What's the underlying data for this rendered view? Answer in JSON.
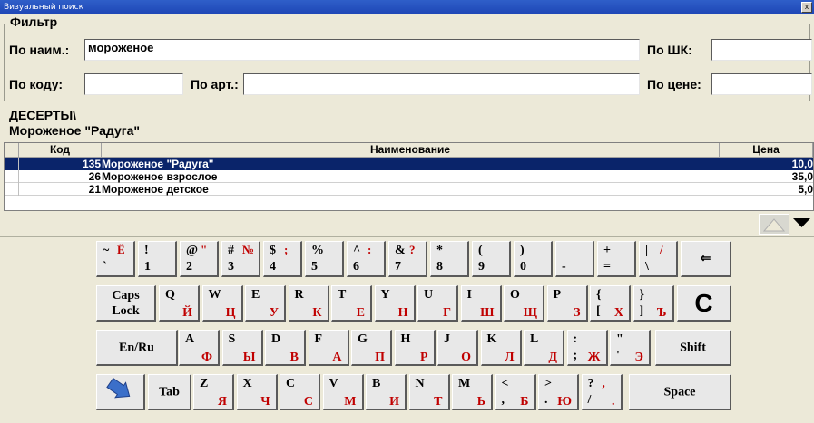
{
  "window": {
    "title": "Визуальный поиск",
    "close_glyph": "x"
  },
  "filter": {
    "legend": "Фильтр",
    "name_label": "По наим.:",
    "name_value": "мороженое",
    "barcode_label": "По ШК:",
    "barcode_value": "",
    "code_label": "По коду:",
    "code_value": "",
    "article_label": "По арт.:",
    "article_value": "",
    "price_label": "По цене:",
    "price_value": ""
  },
  "breadcrumb": {
    "folder": "ДЕСЕРТЫ\\",
    "item": "Мороженое \"Радуга\""
  },
  "table": {
    "headers": {
      "code": "Код",
      "name": "Наименование",
      "price": "Цена"
    },
    "rows": [
      {
        "code": "135",
        "name": "Мороженое \"Радуга\"",
        "price": "10,0",
        "selected": true
      },
      {
        "code": "26",
        "name": "Мороженое взрослое",
        "price": "35,0",
        "selected": false
      },
      {
        "code": "21",
        "name": "Мороженое детское",
        "price": "5,0",
        "selected": false
      }
    ]
  },
  "keyboard": {
    "row1": [
      {
        "t": "~",
        "r": "Ё",
        "b": "`",
        "rb": ""
      },
      {
        "t": "!",
        "r": "",
        "b": "1",
        "rb": ""
      },
      {
        "t": "@",
        "r": "\"",
        "b": "2",
        "rb": ""
      },
      {
        "t": "#",
        "r": "№",
        "b": "3",
        "rb": ""
      },
      {
        "t": "$",
        "r": ";",
        "b": "4",
        "rb": ""
      },
      {
        "t": "%",
        "r": "",
        "b": "5",
        "rb": ""
      },
      {
        "t": "^",
        "r": ":",
        "b": "6",
        "rb": ""
      },
      {
        "t": "&",
        "r": "?",
        "b": "7",
        "rb": ""
      },
      {
        "t": "*",
        "r": "",
        "b": "8",
        "rb": ""
      },
      {
        "t": "(",
        "r": "",
        "b": "9",
        "rb": ""
      },
      {
        "t": ")",
        "r": "",
        "b": "0",
        "rb": ""
      },
      {
        "t": "_",
        "r": "",
        "b": "-",
        "rb": ""
      },
      {
        "t": "+",
        "r": "",
        "b": "=",
        "rb": ""
      },
      {
        "t": "|",
        "r": "/",
        "b": "\\",
        "rb": ""
      }
    ],
    "backspace": "⇐",
    "caps": "Caps Lock",
    "row2": [
      {
        "t": "Q",
        "rb": "Й"
      },
      {
        "t": "W",
        "rb": "Ц"
      },
      {
        "t": "E",
        "rb": "У"
      },
      {
        "t": "R",
        "rb": "К"
      },
      {
        "t": "T",
        "rb": "Е"
      },
      {
        "t": "Y",
        "rb": "Н"
      },
      {
        "t": "U",
        "rb": "Г"
      },
      {
        "t": "I",
        "rb": "Ш"
      },
      {
        "t": "O",
        "rb": "Щ"
      },
      {
        "t": "P",
        "rb": "З"
      },
      {
        "t": "{",
        "b": "[",
        "rb": "Х"
      },
      {
        "t": "}",
        "b": "]",
        "rb": "Ъ"
      }
    ],
    "clear": "C",
    "lang": "En/Ru",
    "row3": [
      {
        "t": "A",
        "rb": "Ф"
      },
      {
        "t": "S",
        "rb": "Ы"
      },
      {
        "t": "D",
        "rb": "В"
      },
      {
        "t": "F",
        "rb": "А"
      },
      {
        "t": "G",
        "rb": "П"
      },
      {
        "t": "H",
        "rb": "Р"
      },
      {
        "t": "J",
        "rb": "О"
      },
      {
        "t": "K",
        "rb": "Л"
      },
      {
        "t": "L",
        "rb": "Д"
      },
      {
        "t": ":",
        "b": ";",
        "rb": "Ж"
      },
      {
        "t": "\"",
        "b": "'",
        "rb": "Э"
      }
    ],
    "shift": "Shift",
    "tab": "Tab",
    "row4": [
      {
        "t": "Z",
        "rb": "Я"
      },
      {
        "t": "X",
        "rb": "Ч"
      },
      {
        "t": "C",
        "rb": "С"
      },
      {
        "t": "V",
        "rb": "М"
      },
      {
        "t": "B",
        "rb": "И"
      },
      {
        "t": "N",
        "rb": "Т"
      },
      {
        "t": "M",
        "rb": "Ь"
      },
      {
        "t": "<",
        "b": ",",
        "rb": "Б"
      },
      {
        "t": ">",
        "b": ".",
        "rb": "Ю"
      },
      {
        "t": "?",
        "r": ",",
        "b": "/",
        "rb": "."
      }
    ],
    "space": "Space"
  }
}
